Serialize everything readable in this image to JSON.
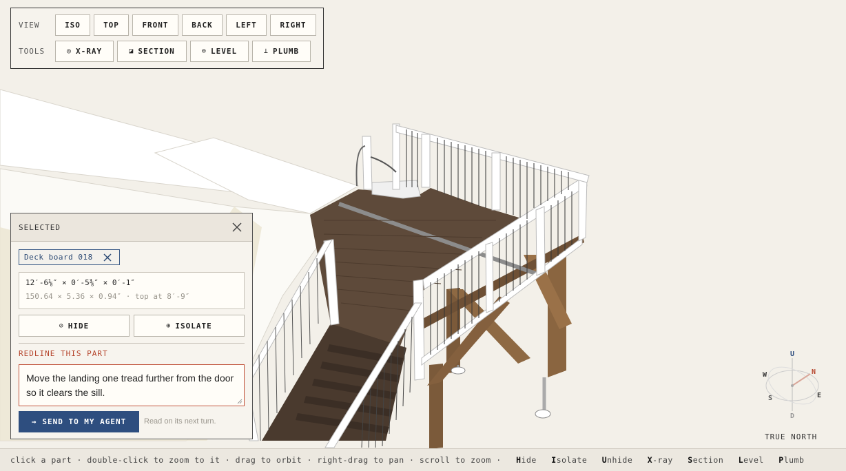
{
  "toolbar": {
    "view_label": "VIEW",
    "tools_label": "TOOLS",
    "views": [
      "ISO",
      "TOP",
      "FRONT",
      "BACK",
      "LEFT",
      "RIGHT"
    ],
    "tools": [
      {
        "label": "X-RAY",
        "icon": "eye-icon"
      },
      {
        "label": "SECTION",
        "icon": "section-icon"
      },
      {
        "label": "LEVEL",
        "icon": "level-icon"
      },
      {
        "label": "PLUMB",
        "icon": "plumb-icon"
      }
    ]
  },
  "panel": {
    "title": "SELECTED",
    "chip_label": "Deck board 018",
    "dims_primary": "12′-6⅛″ × 0′-5⅜″ × 0′-1″",
    "dims_secondary": "150.64 × 5.36 × 0.94″ · top at 8′-9″",
    "hide_label": "HIDE",
    "isolate_label": "ISOLATE",
    "redline_label": "REDLINE THIS PART",
    "redline_text": "Move the landing one tread further from the door so it clears the sill.",
    "send_label": "SEND TO MY AGENT",
    "send_note": "Read on its next turn."
  },
  "compass": {
    "up": "U",
    "down": "D",
    "north": "N",
    "south": "S",
    "east": "E",
    "west": "W",
    "caption": "TRUE NORTH",
    "north_color": "#b5442b"
  },
  "status": {
    "hint": "click a part · double-click to zoom to it · drag to orbit · right-drag to pan · scroll to zoom ·",
    "shortcuts": [
      {
        "key": "H",
        "rest": "ide"
      },
      {
        "key": "I",
        "rest": "solate"
      },
      {
        "key": "U",
        "rest": "nhide"
      },
      {
        "key": "X",
        "rest": "-ray"
      },
      {
        "key": "S",
        "rest": "ection"
      },
      {
        "key": "L",
        "rest": "evel"
      },
      {
        "key": "P",
        "rest": "lumb"
      }
    ]
  },
  "colors": {
    "accent": "#2e4e7f",
    "redline": "#b5442b",
    "deck": "#5e4a3a",
    "framing": "#8a6540",
    "railing": "#ffffff",
    "background": "#f3f0e9"
  }
}
